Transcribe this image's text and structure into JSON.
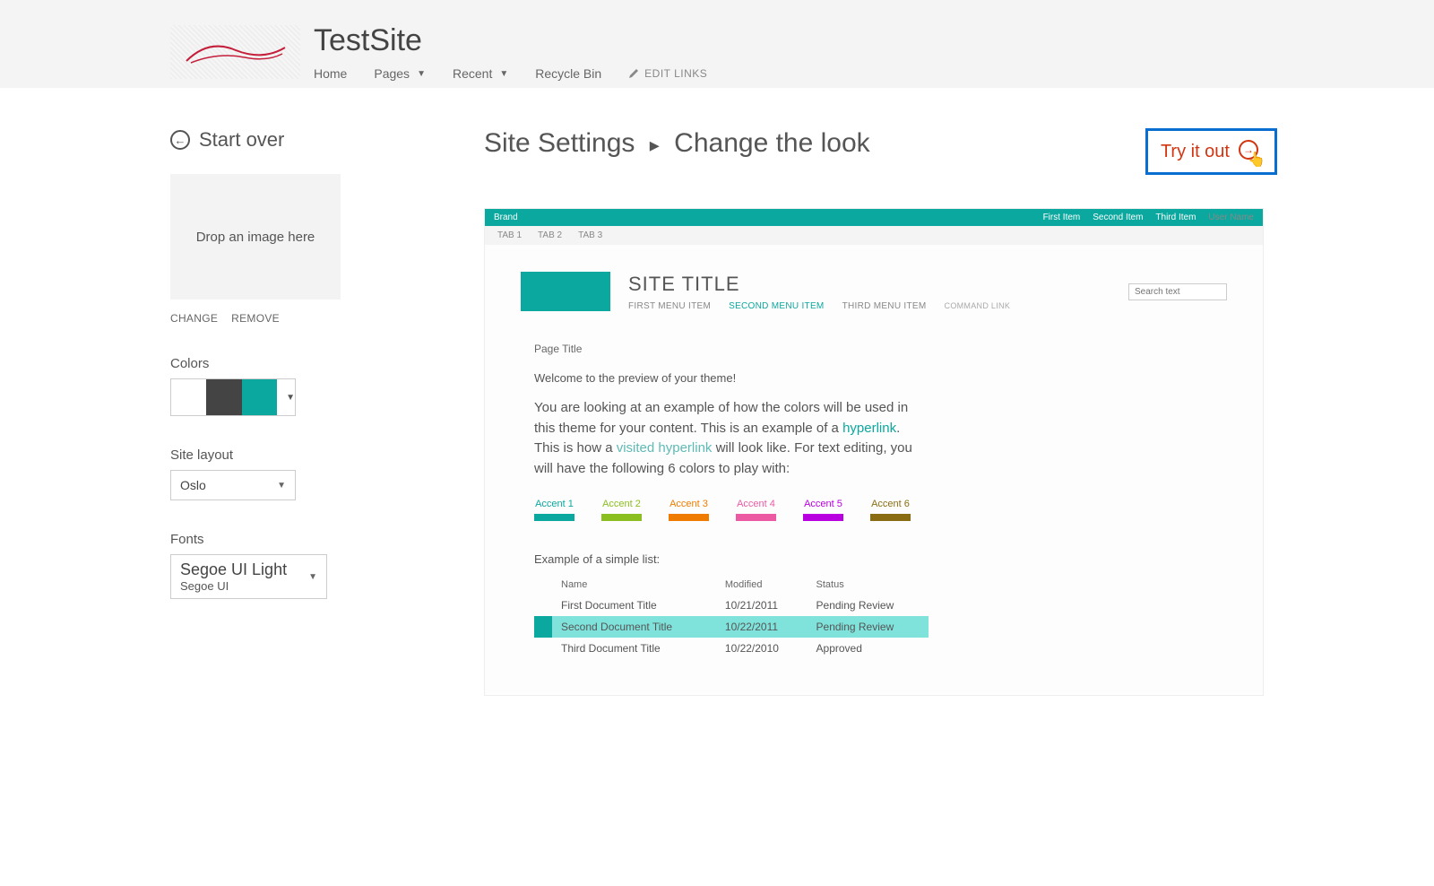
{
  "header": {
    "site_title": "TestSite",
    "nav": {
      "home": "Home",
      "pages": "Pages",
      "recent": "Recent",
      "recycle": "Recycle Bin",
      "edit_links": "EDIT LINKS"
    }
  },
  "sidebar": {
    "start_over": "Start over",
    "drop_text": "Drop an image here",
    "change": "CHANGE",
    "remove": "REMOVE",
    "colors_label": "Colors",
    "colors": {
      "c1": "#ffffff",
      "c2": "#444444",
      "c3": "#0aa89e"
    },
    "layout_label": "Site layout",
    "layout_value": "Oslo",
    "fonts_label": "Fonts",
    "font_primary": "Segoe UI Light",
    "font_secondary": "Segoe UI"
  },
  "content": {
    "breadcrumb_parent": "Site Settings",
    "breadcrumb_current": "Change the look",
    "try_it_out": "Try it out"
  },
  "preview": {
    "brand": "Brand",
    "top_items": [
      "First Item",
      "Second Item",
      "Third Item"
    ],
    "username": "User Name",
    "tabs": [
      "TAB 1",
      "TAB 2",
      "TAB 3"
    ],
    "site_title": "SITE TITLE",
    "menu": {
      "first": "FIRST MENU ITEM",
      "second": "SECOND MENU ITEM",
      "third": "THIRD MENU ITEM",
      "cmd": "COMMAND LINK"
    },
    "search_placeholder": "Search text",
    "page_title": "Page Title",
    "welcome": "Welcome to the preview of your theme!",
    "para_1": "You are looking at an example of how the colors will be used in this theme for your content. This is an example of a ",
    "hyperlink": "hyperlink",
    "para_2": ". This is how a ",
    "visited_link": "visited hyperlink",
    "para_3": " will look like. For text editing, you will have the following 6 colors to play with:",
    "accents": [
      {
        "label": "Accent 1",
        "color": "#0aa89e"
      },
      {
        "label": "Accent 2",
        "color": "#8bbf1f"
      },
      {
        "label": "Accent 3",
        "color": "#ef7c00"
      },
      {
        "label": "Accent 4",
        "color": "#ec5aa4"
      },
      {
        "label": "Accent 5",
        "color": "#b800e0"
      },
      {
        "label": "Accent 6",
        "color": "#8a6d12"
      }
    ],
    "list_title": "Example of a simple list:",
    "columns": [
      "Name",
      "Modified",
      "Status"
    ],
    "rows": [
      {
        "name": "First Document Title",
        "modified": "10/21/2011",
        "status": "Pending Review",
        "selected": false
      },
      {
        "name": "Second Document Title",
        "modified": "10/22/2011",
        "status": "Pending Review",
        "selected": true
      },
      {
        "name": "Third Document Title",
        "modified": "10/22/2010",
        "status": "Approved",
        "selected": false
      }
    ]
  }
}
